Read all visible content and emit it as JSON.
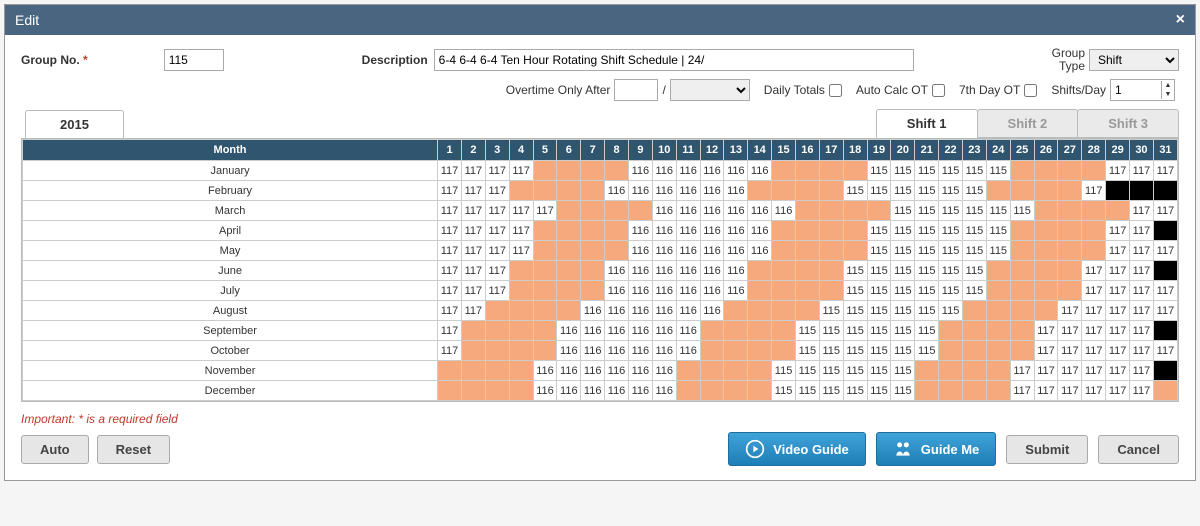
{
  "window": {
    "title": "Edit"
  },
  "form": {
    "group_no_label": "Group No.",
    "group_no": "115",
    "description_label": "Description",
    "description": "6-4 6-4 6-4 Ten Hour Rotating Shift Schedule | 24/",
    "group_type_label_line1": "Group",
    "group_type_label_line2": "Type",
    "group_type": "Shift",
    "overtime_label": "Overtime Only After",
    "overtime_hours": "",
    "overtime_select": "",
    "daily_totals_label": "Daily Totals",
    "auto_calc_ot_label": "Auto Calc OT",
    "seventh_day_ot_label": "7th Day OT",
    "shifts_day_label": "Shifts/Day",
    "shifts_day": "1"
  },
  "tabs": {
    "year": "2015",
    "shifts": [
      "Shift 1",
      "Shift 2",
      "Shift 3"
    ],
    "active_shift": 0
  },
  "table": {
    "month_header": "Month",
    "day_headers": [
      "1",
      "2",
      "3",
      "4",
      "5",
      "6",
      "7",
      "8",
      "9",
      "10",
      "11",
      "12",
      "13",
      "14",
      "15",
      "16",
      "17",
      "18",
      "19",
      "20",
      "21",
      "22",
      "23",
      "24",
      "25",
      "26",
      "27",
      "28",
      "29",
      "30",
      "31"
    ],
    "months": [
      "January",
      "February",
      "March",
      "April",
      "May",
      "June",
      "July",
      "August",
      "September",
      "October",
      "November",
      "December"
    ],
    "cells": [
      [
        "117",
        "117",
        "117",
        "117",
        "",
        "",
        "",
        "",
        "116",
        "116",
        "116",
        "116",
        "116",
        "116",
        "",
        "",
        "",
        "",
        "115",
        "115",
        "115",
        "115",
        "115",
        "115",
        "",
        "",
        "",
        "",
        "117",
        "117",
        "117"
      ],
      [
        "117",
        "117",
        "117",
        "",
        "",
        "",
        "",
        "116",
        "116",
        "116",
        "116",
        "116",
        "116",
        "",
        "",
        "",
        "",
        "115",
        "115",
        "115",
        "115",
        "115",
        "115",
        "",
        "",
        "",
        "",
        "117",
        "X",
        "X",
        "X"
      ],
      [
        "117",
        "117",
        "117",
        "117",
        "117",
        "",
        "",
        "",
        "",
        "116",
        "116",
        "116",
        "116",
        "116",
        "116",
        "",
        "",
        "",
        "",
        "115",
        "115",
        "115",
        "115",
        "115",
        "115",
        "",
        "",
        "",
        "",
        "117",
        "117"
      ],
      [
        "117",
        "117",
        "117",
        "117",
        "",
        "",
        "",
        "",
        "116",
        "116",
        "116",
        "116",
        "116",
        "116",
        "",
        "",
        "",
        "",
        "115",
        "115",
        "115",
        "115",
        "115",
        "115",
        "",
        "",
        "",
        "",
        "117",
        "117",
        "X"
      ],
      [
        "117",
        "117",
        "117",
        "117",
        "",
        "",
        "",
        "",
        "116",
        "116",
        "116",
        "116",
        "116",
        "116",
        "",
        "",
        "",
        "",
        "115",
        "115",
        "115",
        "115",
        "115",
        "115",
        "",
        "",
        "",
        "",
        "117",
        "117",
        "117"
      ],
      [
        "117",
        "117",
        "117",
        "",
        "",
        "",
        "",
        "116",
        "116",
        "116",
        "116",
        "116",
        "116",
        "",
        "",
        "",
        "",
        "115",
        "115",
        "115",
        "115",
        "115",
        "115",
        "",
        "",
        "",
        "",
        "117",
        "117",
        "117",
        "X"
      ],
      [
        "117",
        "117",
        "117",
        "",
        "",
        "",
        "",
        "116",
        "116",
        "116",
        "116",
        "116",
        "116",
        "",
        "",
        "",
        "",
        "115",
        "115",
        "115",
        "115",
        "115",
        "115",
        "",
        "",
        "",
        "",
        "117",
        "117",
        "117",
        "117"
      ],
      [
        "117",
        "117",
        "",
        "",
        "",
        "",
        "116",
        "116",
        "116",
        "116",
        "116",
        "116",
        "",
        "",
        "",
        "",
        "115",
        "115",
        "115",
        "115",
        "115",
        "115",
        "",
        "",
        "",
        "",
        "117",
        "117",
        "117",
        "117",
        "117"
      ],
      [
        "117",
        "",
        "",
        "",
        "",
        "116",
        "116",
        "116",
        "116",
        "116",
        "116",
        "",
        "",
        "",
        "",
        "115",
        "115",
        "115",
        "115",
        "115",
        "115",
        "",
        "",
        "",
        "",
        "117",
        "117",
        "117",
        "117",
        "117",
        "X"
      ],
      [
        "117",
        "",
        "",
        "",
        "",
        "116",
        "116",
        "116",
        "116",
        "116",
        "116",
        "",
        "",
        "",
        "",
        "115",
        "115",
        "115",
        "115",
        "115",
        "115",
        "",
        "",
        "",
        "",
        "117",
        "117",
        "117",
        "117",
        "117",
        "117"
      ],
      [
        "",
        "",
        "",
        "",
        "116",
        "116",
        "116",
        "116",
        "116",
        "116",
        "",
        "",
        "",
        "",
        "115",
        "115",
        "115",
        "115",
        "115",
        "115",
        "",
        "",
        "",
        "",
        "117",
        "117",
        "117",
        "117",
        "117",
        "117",
        "X"
      ],
      [
        "",
        "",
        "",
        "",
        "116",
        "116",
        "116",
        "116",
        "116",
        "116",
        "",
        "",
        "",
        "",
        "115",
        "115",
        "115",
        "115",
        "115",
        "115",
        "",
        "",
        "",
        "",
        "117",
        "117",
        "117",
        "117",
        "117",
        "117",
        ""
      ]
    ]
  },
  "important_text": "Important: * is a required field",
  "buttons": {
    "auto": "Auto",
    "reset": "Reset",
    "video_guide": "Video Guide",
    "guide_me": "Guide Me",
    "submit": "Submit",
    "cancel": "Cancel"
  }
}
